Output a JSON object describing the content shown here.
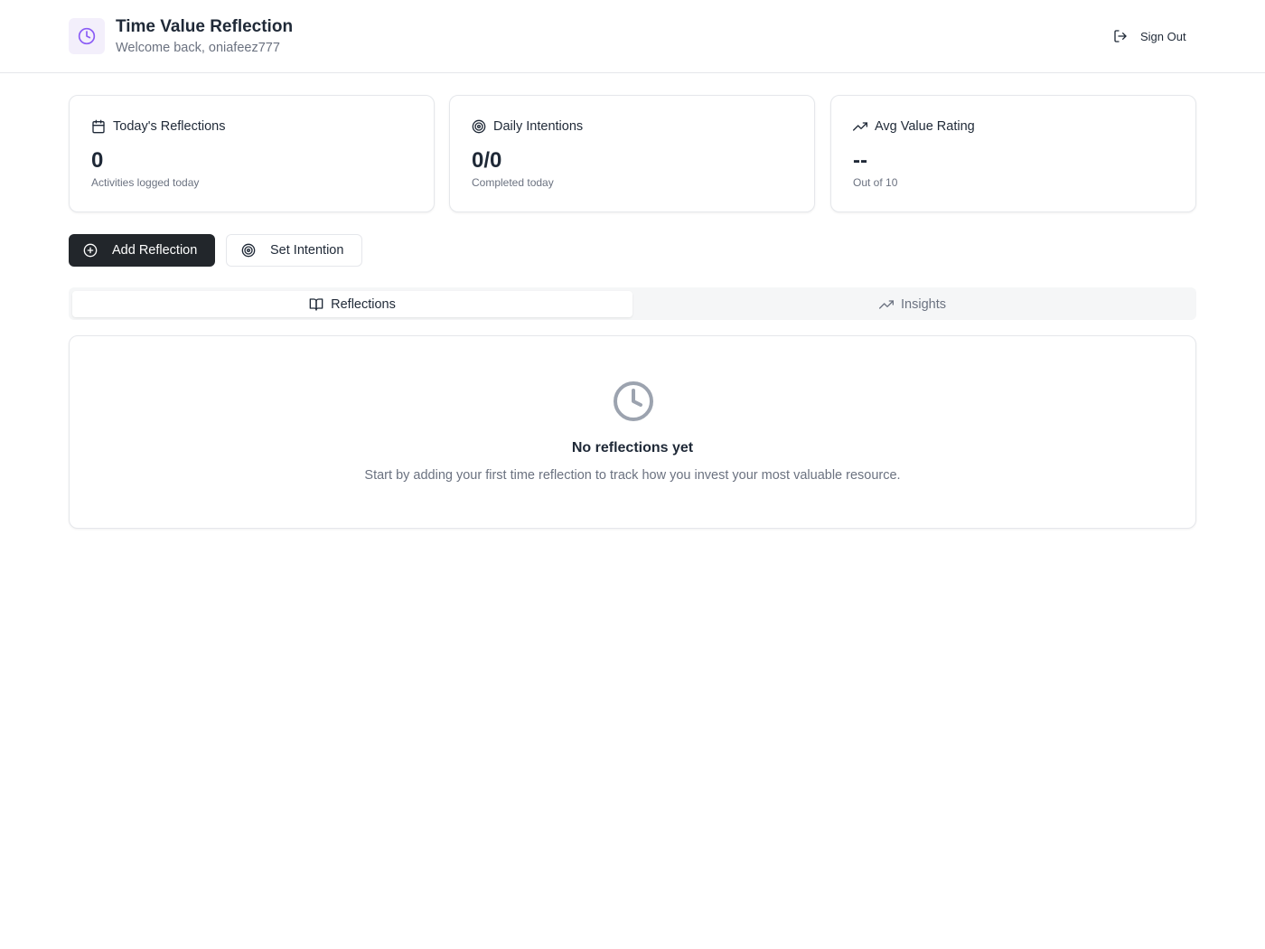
{
  "header": {
    "title": "Time Value Reflection",
    "subtitle": "Welcome back, oniafeez777",
    "logo_icon": "clock-icon",
    "sign_out_label": "Sign Out",
    "accent_color": "#8b5cf6"
  },
  "stats": [
    {
      "icon": "calendar-icon",
      "label": "Today's Reflections",
      "value": "0",
      "sub": "Activities logged today"
    },
    {
      "icon": "target-icon",
      "label": "Daily Intentions",
      "value": "0/0",
      "sub": "Completed today"
    },
    {
      "icon": "trending-up-icon",
      "label": "Avg Value Rating",
      "value": "--",
      "sub": "Out of 10"
    }
  ],
  "actions": {
    "add_reflection_label": "Add Reflection",
    "set_intention_label": "Set Intention"
  },
  "tabs": [
    {
      "label": "Reflections",
      "icon": "book-open-icon",
      "active": true
    },
    {
      "label": "Insights",
      "icon": "trending-up-icon",
      "active": false
    }
  ],
  "empty_state": {
    "icon": "clock-icon",
    "title": "No reflections yet",
    "text": "Start by adding your first time reflection to track how you invest your most valuable resource."
  }
}
